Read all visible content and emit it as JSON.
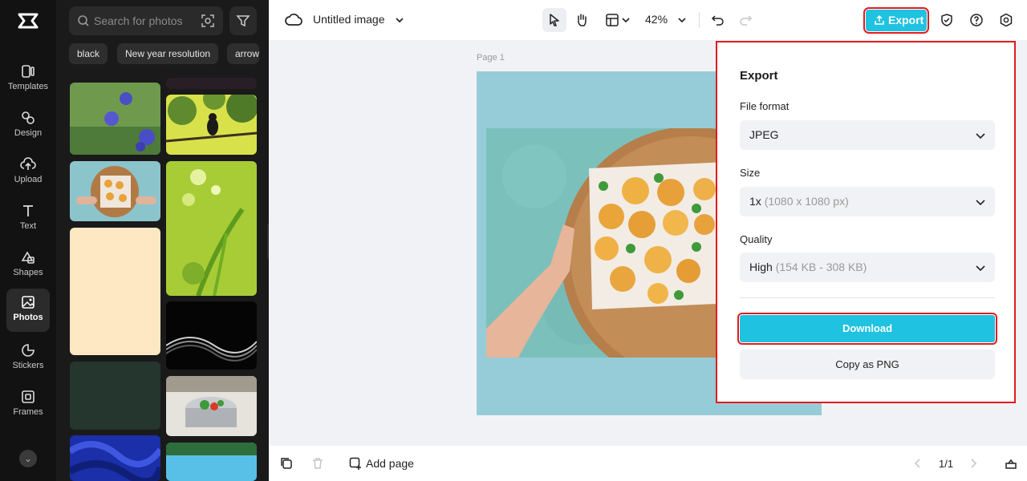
{
  "rail": {
    "items": [
      {
        "label": "Templates",
        "icon": "templates-icon"
      },
      {
        "label": "Design",
        "icon": "design-icon"
      },
      {
        "label": "Upload",
        "icon": "upload-icon"
      },
      {
        "label": "Text",
        "icon": "text-icon"
      },
      {
        "label": "Shapes",
        "icon": "shapes-icon"
      },
      {
        "label": "Photos",
        "icon": "photos-icon"
      },
      {
        "label": "Stickers",
        "icon": "stickers-icon"
      },
      {
        "label": "Frames",
        "icon": "frames-icon"
      }
    ],
    "active": "Photos"
  },
  "photos_panel": {
    "search_placeholder": "Search for photos",
    "chips": [
      "black",
      "New year resolution",
      "arrow"
    ]
  },
  "topbar": {
    "title": "Untitled image",
    "zoom": "42%",
    "export_label": "Export"
  },
  "canvas": {
    "page_label": "Page 1"
  },
  "bottombar": {
    "add_page_label": "Add page",
    "page_count": "1/1"
  },
  "export_panel": {
    "title": "Export",
    "file_format_label": "File format",
    "file_format_value": "JPEG",
    "size_label": "Size",
    "size_value": "1x",
    "size_detail": "(1080 x 1080 px)",
    "quality_label": "Quality",
    "quality_value": "High",
    "quality_detail": "(154 KB - 308 KB)",
    "download_label": "Download",
    "copy_label": "Copy as PNG"
  },
  "colors": {
    "accent": "#1fc2e0",
    "highlight": "#e5191d",
    "rail_bg": "#121212",
    "panel_bg": "#1a1a1a",
    "page_bg": "#96ccd8"
  }
}
